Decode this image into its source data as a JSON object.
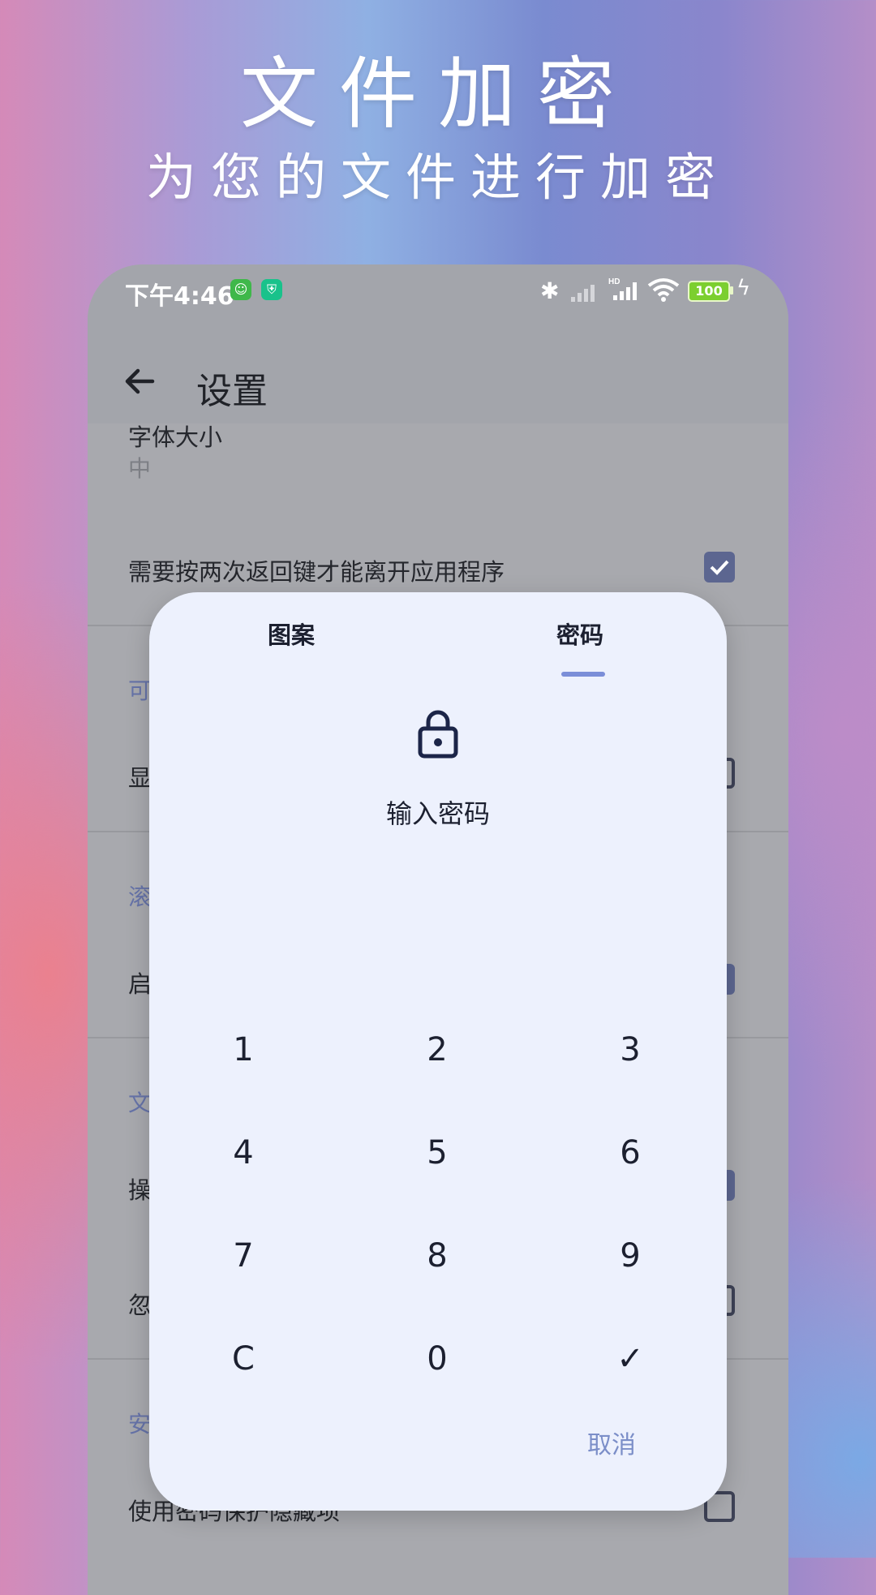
{
  "hero": {
    "title": "文件加密",
    "subtitle": "为您的文件进行加密"
  },
  "status_bar": {
    "time": "下午4:46",
    "battery": "100",
    "icons": [
      "cat-app-icon",
      "shield-app-icon",
      "bluetooth-icon",
      "signal-icon",
      "hd-signal-icon",
      "wifi-icon",
      "battery-icon",
      "charging-icon"
    ]
  },
  "app_bar": {
    "title": "设置",
    "back_icon": "arrow-left-icon"
  },
  "settings": {
    "font_size_label": "字体大小",
    "font_size_value": "中",
    "double_back_label": "需要按两次返回键才能离开应用程序",
    "section_visible_partial": "可",
    "show_partial": "显",
    "section_scroll_partial": "滚",
    "enable_partial": "启",
    "section_file_partial": "文",
    "operation_partial": "操",
    "ignore_partial": "忽",
    "section_security_partial": "安",
    "password_protect_label": "使用密码保护隐藏项"
  },
  "dialog": {
    "tabs": [
      "图案",
      "密码"
    ],
    "active_tab": "密码",
    "lock_icon": "lock-icon",
    "title": "输入密码",
    "keys": [
      "1",
      "2",
      "3",
      "4",
      "5",
      "6",
      "7",
      "8",
      "9",
      "C",
      "0",
      "✓"
    ],
    "cancel_label": "取消"
  },
  "colors": {
    "accent": "#7b8ed8",
    "checkbox_on": "#5c6690",
    "dialog_bg": "#edf1fd"
  }
}
